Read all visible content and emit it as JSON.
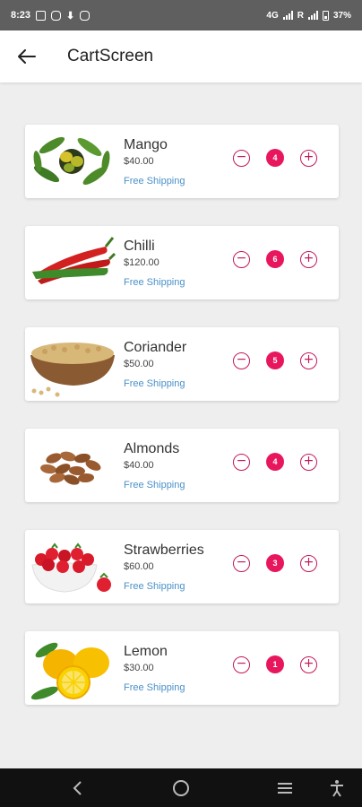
{
  "status_bar": {
    "time": "8:23",
    "network": "4G",
    "roaming": "R",
    "battery": "37%",
    "left_icons": [
      "messages-icon",
      "instagram-icon",
      "download-icon",
      "instagram-icon"
    ]
  },
  "app_bar": {
    "title": "CartScreen",
    "back_icon": "arrow-left-icon"
  },
  "cart_items": [
    {
      "name": "Mango",
      "price": "$40.00",
      "shipping": "Free Shipping",
      "quantity": "4",
      "image": "mango-leaves-image"
    },
    {
      "name": "Chilli",
      "price": "$120.00",
      "shipping": "Free Shipping",
      "quantity": "6",
      "image": "red-green-chilli-image"
    },
    {
      "name": "Coriander",
      "price": "$50.00",
      "shipping": "Free Shipping",
      "quantity": "5",
      "image": "coriander-seeds-bowl-image"
    },
    {
      "name": "Almonds",
      "price": "$40.00",
      "shipping": "Free Shipping",
      "quantity": "4",
      "image": "almonds-image"
    },
    {
      "name": "Strawberries",
      "price": "$60.00",
      "shipping": "Free Shipping",
      "quantity": "3",
      "image": "strawberries-bowl-image"
    },
    {
      "name": "Lemon",
      "price": "$30.00",
      "shipping": "Free Shipping",
      "quantity": "1",
      "image": "lemons-image"
    }
  ],
  "colors": {
    "accent": "#e8175d",
    "outline": "#c2185b",
    "link": "#4a90c8",
    "background": "#eeeeee"
  },
  "nav_bar": {
    "buttons": [
      "back-icon",
      "home-icon",
      "recents-icon",
      "accessibility-icon"
    ]
  }
}
